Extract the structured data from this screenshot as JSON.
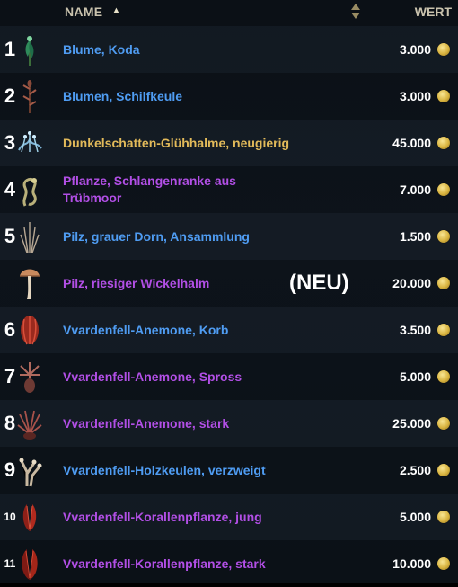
{
  "header": {
    "name_label": "NAME",
    "sort_arrow": "▲",
    "value_label": "WERT"
  },
  "rows": [
    {
      "num": "1",
      "name": "Blume, Koda",
      "quality": "blue",
      "price": "3.000",
      "icon": "plant-icon"
    },
    {
      "num": "2",
      "name": "Blumen, Schilfkeule",
      "quality": "blue",
      "price": "3.000",
      "icon": "plant-icon"
    },
    {
      "num": "3",
      "name": "Dunkelschatten-Glühhalme, neugierig",
      "quality": "gold",
      "price": "45.000",
      "icon": "plant-icon"
    },
    {
      "num": "4",
      "name": "Pflanze, Schlangenranke aus Trübmoor",
      "quality": "purple",
      "price": "7.000",
      "icon": "plant-icon"
    },
    {
      "num": "5",
      "name": "Pilz, grauer Dorn, Ansammlung",
      "quality": "blue",
      "price": "1.500",
      "icon": "plant-icon"
    },
    {
      "num": "",
      "name": "Pilz, riesiger Wickelhalm",
      "quality": "purple",
      "price": "20.000",
      "icon": "mushroom-icon",
      "tag": "(NEU)"
    },
    {
      "num": "6",
      "name": "Vvardenfell-Anemone, Korb",
      "quality": "blue",
      "price": "3.500",
      "icon": "anemone-icon"
    },
    {
      "num": "7",
      "name": "Vvardenfell-Anemone, Spross",
      "quality": "purple",
      "price": "5.000",
      "icon": "anemone-icon"
    },
    {
      "num": "8",
      "name": "Vvardenfell-Anemone, stark",
      "quality": "purple",
      "price": "25.000",
      "icon": "anemone-icon"
    },
    {
      "num": "9",
      "name": "Vvardenfell-Holzkeulen, verzweigt",
      "quality": "blue",
      "price": "2.500",
      "icon": "plant-icon"
    },
    {
      "num": "10",
      "name": "Vvardenfell-Korallenpflanze, jung",
      "quality": "purple",
      "price": "5.000",
      "icon": "coral-icon"
    },
    {
      "num": "11",
      "name": "Vvardenfell-Korallenpflanze, stark",
      "quality": "purple",
      "price": "10.000",
      "icon": "coral-icon"
    }
  ],
  "colors": {
    "blue": "#4f9cf2",
    "purple": "#b24fe6",
    "gold": "#e2ba5a"
  }
}
